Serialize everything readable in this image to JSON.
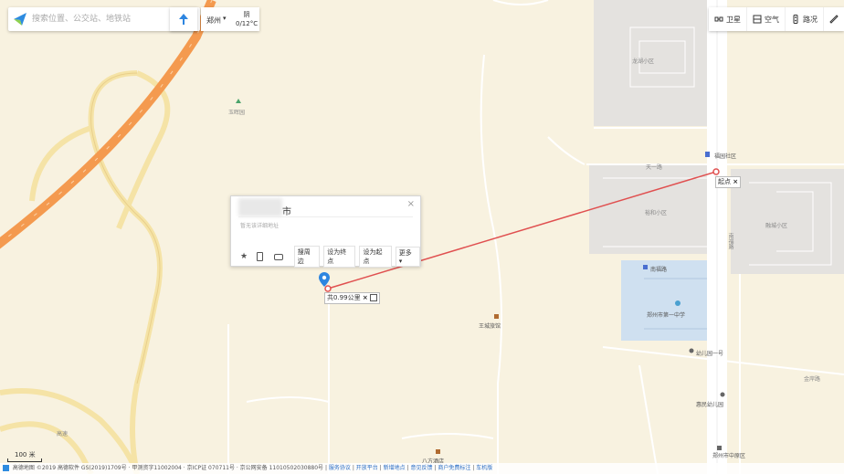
{
  "search": {
    "placeholder": "搜索位置、公交站、地铁站"
  },
  "city": {
    "name": "郑州",
    "weather_condition": "阴",
    "temperature": "0/12°C"
  },
  "toolbar": {
    "items": [
      {
        "label": "卫星",
        "icon": "satellite-icon"
      },
      {
        "label": "空气",
        "icon": "air-icon"
      },
      {
        "label": "路况",
        "icon": "traffic-icon"
      },
      {
        "label": "",
        "icon": "ruler-icon"
      }
    ]
  },
  "popup": {
    "title": "市",
    "subtitle": "暂无该详细地址",
    "actions": [
      "搜周边",
      "设为终点",
      "设为起点",
      "更多"
    ]
  },
  "measure": {
    "start_label": "起点",
    "distance_label": "共0.99公里"
  },
  "labels": {
    "villa": "玉晖园",
    "north_area": "龙湖小区",
    "poi_top": "福园社区",
    "mid_block": "天一路",
    "right_area": "融城小区",
    "school_top": "裕和小区",
    "road_south": "南福路",
    "school": "郑州市第一中学",
    "kindergarten": "幼儿园一号",
    "kindergarten2": "惠民幼儿园",
    "hotel": "王城旅馆",
    "road_right": "金岸路",
    "bottom_poi": "八方酒店",
    "bottom_right": "郑州市中原区",
    "far_left": "高速",
    "road_label": "南福路"
  },
  "scale": {
    "label": "100 米"
  },
  "footer": {
    "copyright": "高德地图 ©2019 高德软件 GS(2019)1709号 · 甲测资字11002004 · 京ICP证 070711号 · 京公网安备 11010502030880号",
    "links": [
      "服务协议",
      "开放平台",
      "新增地点",
      "意见反馈",
      "商户免费标注",
      "车机版"
    ]
  },
  "colors": {
    "land": "#f8f2e0",
    "highway": "#f4a259",
    "major_road": "#fbe8a9",
    "block": "#e5e3df",
    "water": "#c9def0",
    "measure_line": "#e05050",
    "marker": "#2d85e0"
  }
}
